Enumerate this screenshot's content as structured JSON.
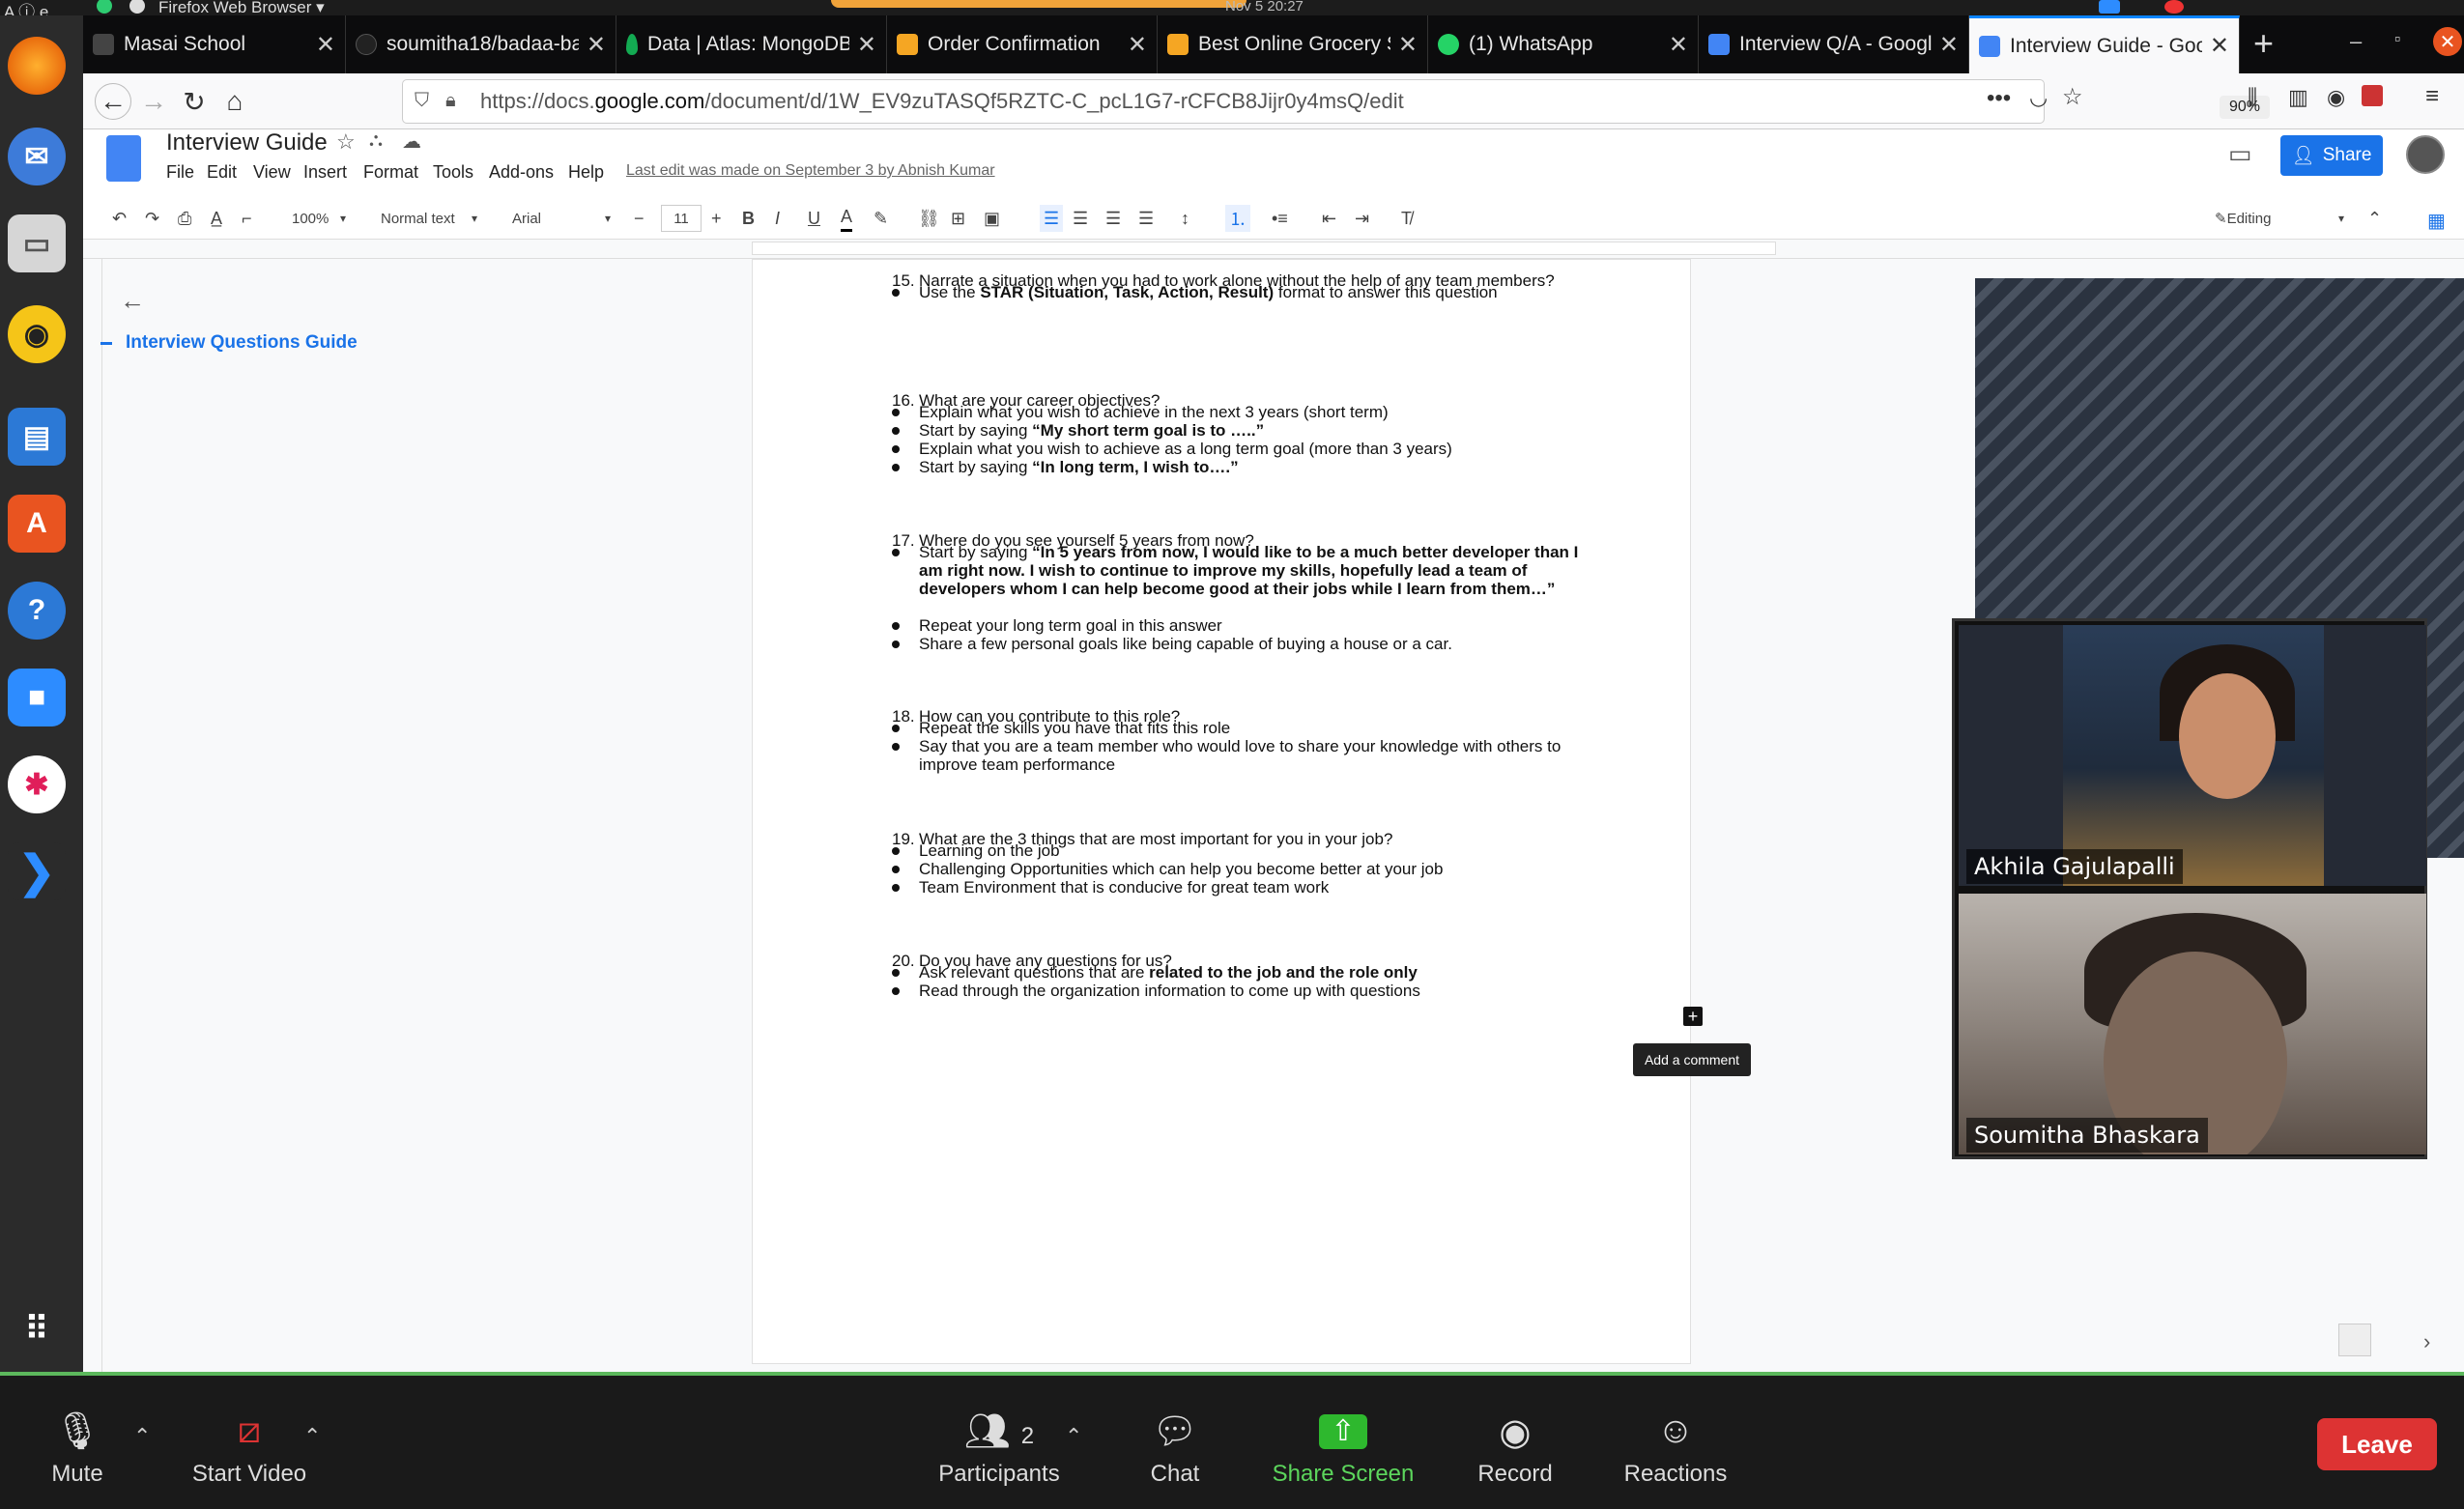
{
  "system": {
    "left_label": "A ⓘ e",
    "browser_label": "Firefox Web Browser ▾",
    "clock": "Nov 5  20:27"
  },
  "tabs": [
    {
      "title": "Masai School",
      "color": "#444"
    },
    {
      "title": "soumitha18/badaa-ba",
      "color": "#222"
    },
    {
      "title": "Data | Atlas: MongoDB",
      "color": "#13aa52"
    },
    {
      "title": "Order Confirmation",
      "color": "#f5a623"
    },
    {
      "title": "Best Online Grocery S",
      "color": "#f5a623"
    },
    {
      "title": "(1) WhatsApp",
      "color": "#25d366"
    },
    {
      "title": "Interview Q/A - Google",
      "color": "#4285f4"
    },
    {
      "title": "Interview Guide - Goo",
      "color": "#4285f4"
    }
  ],
  "new_tab": "+",
  "url": {
    "prefix": "https://docs.",
    "domain": "google.com",
    "suffix": "/document/d/1W_EV9zuTASQf5RZTC-C_pcL1G7-rCFCB8Jijr0y4msQ/edit",
    "zoom": "90%"
  },
  "docs": {
    "title": "Interview Guide",
    "menus": [
      "File",
      "Edit",
      "View",
      "Insert",
      "Format",
      "Tools",
      "Add-ons",
      "Help"
    ],
    "last_edit": "Last edit was made on September 3 by Abnish Kumar",
    "share": "Share",
    "toolbar": {
      "zoom": "100%",
      "style": "Normal text",
      "font": "Arial",
      "size": "11",
      "editing": "Editing"
    },
    "outline_item": "Interview Questions Guide",
    "add_comment": "Add a comment"
  },
  "questions": [
    {
      "num": "15.",
      "text": "Narrate a situation when you had to work alone without the help of any team members?",
      "bullets": [
        {
          "pre": "Use the ",
          "bold": "STAR (Situation, Task, Action, Result)",
          "post": " format to answer this question"
        }
      ]
    },
    {
      "num": "16.",
      "text": "What are your career objectives?",
      "bullets": [
        {
          "pre": "Explain what you wish to achieve in the next 3 years (short term)",
          "bold": "",
          "post": ""
        },
        {
          "pre": "Start by saying ",
          "bold": "“My short term goal is to …..”",
          "post": ""
        },
        {
          "pre": "Explain what you wish to achieve as a long term goal (more than 3 years)",
          "bold": "",
          "post": ""
        },
        {
          "pre": "Start by saying ",
          "bold": "“In long term, I wish to….”",
          "post": ""
        }
      ]
    },
    {
      "num": "17.",
      "text": "Where do you see yourself 5 years from now?",
      "bullets": [
        {
          "pre": "Start by saying ",
          "bold": "“In 5 years from now, I would like to be a much better developer than I am right now. I wish to continue to improve my skills, hopefully lead a team of developers whom I can help become good at their jobs while I learn from them…”",
          "post": ""
        },
        {
          "pre": "Repeat your long term goal in this answer",
          "bold": "",
          "post": ""
        },
        {
          "pre": "Share a few personal goals like being capable of buying a house or a car.",
          "bold": "",
          "post": ""
        }
      ]
    },
    {
      "num": "18.",
      "text": "How can you contribute to this role?",
      "bullets": [
        {
          "pre": "Repeat the skills you have that fits this role",
          "bold": "",
          "post": ""
        },
        {
          "pre": "Say that you are a team member who would love to share your knowledge with others to improve team performance",
          "bold": "",
          "post": ""
        }
      ]
    },
    {
      "num": "19.",
      "text": "What are the 3 things that are most important for you in your job?",
      "bullets": [
        {
          "pre": "Learning on the job",
          "bold": "",
          "post": ""
        },
        {
          "pre": "Challenging Opportunities which can help you become better at your job",
          "bold": "",
          "post": ""
        },
        {
          "pre": "Team Environment that is conducive for great team work",
          "bold": "",
          "post": ""
        }
      ]
    },
    {
      "num": "20.",
      "text": "Do you have any questions for us?",
      "bullets": [
        {
          "pre": "Ask relevant questions that are ",
          "bold": "related to the job and the role only",
          "post": ""
        },
        {
          "pre": "Read through the organization information to come up with questions",
          "bold": "",
          "post": ""
        }
      ]
    }
  ],
  "video": {
    "participant1": "Akhila Gajulapalli",
    "participant2": "Soumitha Bhaskara"
  },
  "zoom": {
    "mute": "Mute",
    "start_video": "Start Video",
    "participants": "Participants",
    "participants_count": "2",
    "chat": "Chat",
    "share_screen": "Share Screen",
    "record": "Record",
    "reactions": "Reactions",
    "leave": "Leave"
  }
}
